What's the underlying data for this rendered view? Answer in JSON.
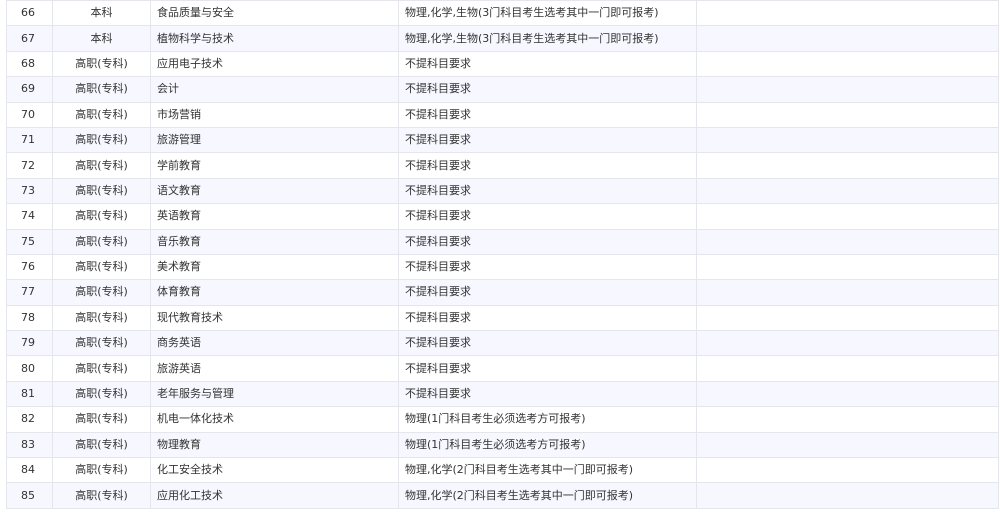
{
  "table": {
    "rows": [
      {
        "idx": "66",
        "level": "本科",
        "major": "食品质量与安全",
        "subject": "物理,化学,生物(3门科目考生选考其中一门即可报考)"
      },
      {
        "idx": "67",
        "level": "本科",
        "major": "植物科学与技术",
        "subject": "物理,化学,生物(3门科目考生选考其中一门即可报考)"
      },
      {
        "idx": "68",
        "level": "高职(专科)",
        "major": "应用电子技术",
        "subject": "不提科目要求"
      },
      {
        "idx": "69",
        "level": "高职(专科)",
        "major": "会计",
        "subject": "不提科目要求"
      },
      {
        "idx": "70",
        "level": "高职(专科)",
        "major": "市场营销",
        "subject": "不提科目要求"
      },
      {
        "idx": "71",
        "level": "高职(专科)",
        "major": "旅游管理",
        "subject": "不提科目要求"
      },
      {
        "idx": "72",
        "level": "高职(专科)",
        "major": "学前教育",
        "subject": "不提科目要求"
      },
      {
        "idx": "73",
        "level": "高职(专科)",
        "major": "语文教育",
        "subject": "不提科目要求"
      },
      {
        "idx": "74",
        "level": "高职(专科)",
        "major": "英语教育",
        "subject": "不提科目要求"
      },
      {
        "idx": "75",
        "level": "高职(专科)",
        "major": "音乐教育",
        "subject": "不提科目要求"
      },
      {
        "idx": "76",
        "level": "高职(专科)",
        "major": "美术教育",
        "subject": "不提科目要求"
      },
      {
        "idx": "77",
        "level": "高职(专科)",
        "major": "体育教育",
        "subject": "不提科目要求"
      },
      {
        "idx": "78",
        "level": "高职(专科)",
        "major": "现代教育技术",
        "subject": "不提科目要求"
      },
      {
        "idx": "79",
        "level": "高职(专科)",
        "major": "商务英语",
        "subject": "不提科目要求"
      },
      {
        "idx": "80",
        "level": "高职(专科)",
        "major": "旅游英语",
        "subject": "不提科目要求"
      },
      {
        "idx": "81",
        "level": "高职(专科)",
        "major": "老年服务与管理",
        "subject": "不提科目要求"
      },
      {
        "idx": "82",
        "level": "高职(专科)",
        "major": "机电一体化技术",
        "subject": "物理(1门科目考生必须选考方可报考)"
      },
      {
        "idx": "83",
        "level": "高职(专科)",
        "major": "物理教育",
        "subject": "物理(1门科目考生必须选考方可报考)"
      },
      {
        "idx": "84",
        "level": "高职(专科)",
        "major": "化工安全技术",
        "subject": "物理,化学(2门科目考生选考其中一门即可报考)"
      },
      {
        "idx": "85",
        "level": "高职(专科)",
        "major": "应用化工技术",
        "subject": "物理,化学(2门科目考生选考其中一门即可报考)"
      }
    ]
  }
}
